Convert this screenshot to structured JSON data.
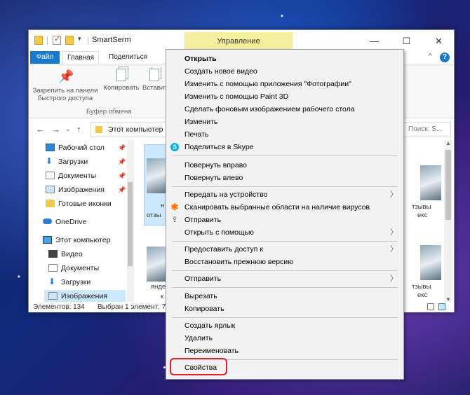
{
  "window": {
    "title": "SmartSerm",
    "manage_tab": "Управление",
    "controls": [
      "—",
      "☐",
      "✕"
    ]
  },
  "ribbon": {
    "tabs": [
      "Файл",
      "Главная",
      "Поделиться"
    ],
    "buttons": {
      "pin_line1": "Закрепить на панели",
      "pin_line2": "быстрого доступа",
      "copy": "Копировать",
      "paste": "Вставит"
    },
    "group_label": "Буфер обмена"
  },
  "address": {
    "path": "Этот компьютер",
    "search_placeholder": "Поиск: S..."
  },
  "nav": {
    "items": [
      {
        "label": "Рабочий стол",
        "pinned": true
      },
      {
        "label": "Загрузки",
        "pinned": true
      },
      {
        "label": "Документы",
        "pinned": true
      },
      {
        "label": "Изображения",
        "pinned": true
      },
      {
        "label": "Готовые иконки",
        "pinned": false
      },
      {
        "label": "OneDrive",
        "pinned": false
      },
      {
        "label": "Этот компьютер",
        "pinned": false
      },
      {
        "label": "Видео",
        "pinned": false
      },
      {
        "label": "Документы",
        "pinned": false
      },
      {
        "label": "Загрузки",
        "pinned": false
      },
      {
        "label": "Изображения",
        "pinned": false
      }
    ]
  },
  "content": {
    "left_fragments": [
      "н",
      "отзы",
      "янде",
      "к"
    ],
    "right_fragments": [
      "тзывы",
      "екс",
      "тзывы",
      "екс"
    ]
  },
  "status": {
    "count": "Элементов: 134",
    "selected": "Выбран 1 элемент: 7"
  },
  "context_menu": {
    "items": [
      {
        "label": "Открыть",
        "bold": true
      },
      {
        "label": "Создать новое видео"
      },
      {
        "label": "Изменить с помощью приложения \"Фотографии\""
      },
      {
        "label": "Изменить с помощью Paint 3D"
      },
      {
        "label": "Сделать фоновым изображением рабочего стола"
      },
      {
        "label": "Изменить"
      },
      {
        "label": "Печать"
      },
      {
        "label": "Поделиться в Skype",
        "icon": "skype-icon"
      },
      {
        "label": "Повернуть вправо"
      },
      {
        "label": "Повернуть влево"
      },
      {
        "label": "Передать на устройство",
        "submenu": true
      },
      {
        "label": "Сканировать выбранные области на наличие вирусов",
        "icon": "avast-icon"
      },
      {
        "label": "Отправить",
        "icon": "share-icon"
      },
      {
        "label": "Открыть с помощью",
        "submenu": true
      },
      {
        "label": "Предоставить доступ к",
        "submenu": true
      },
      {
        "label": "Восстановить прежнюю версию"
      },
      {
        "label": "Отправить",
        "submenu": true
      },
      {
        "label": "Вырезать"
      },
      {
        "label": "Копировать"
      },
      {
        "label": "Создать ярлык"
      },
      {
        "label": "Удалить"
      },
      {
        "label": "Переименовать"
      },
      {
        "label": "Свойства"
      }
    ]
  },
  "colors": {
    "file_tab": "#1979ca",
    "manage_tab": "#f5f0a0",
    "highlight": "#d9262c"
  }
}
